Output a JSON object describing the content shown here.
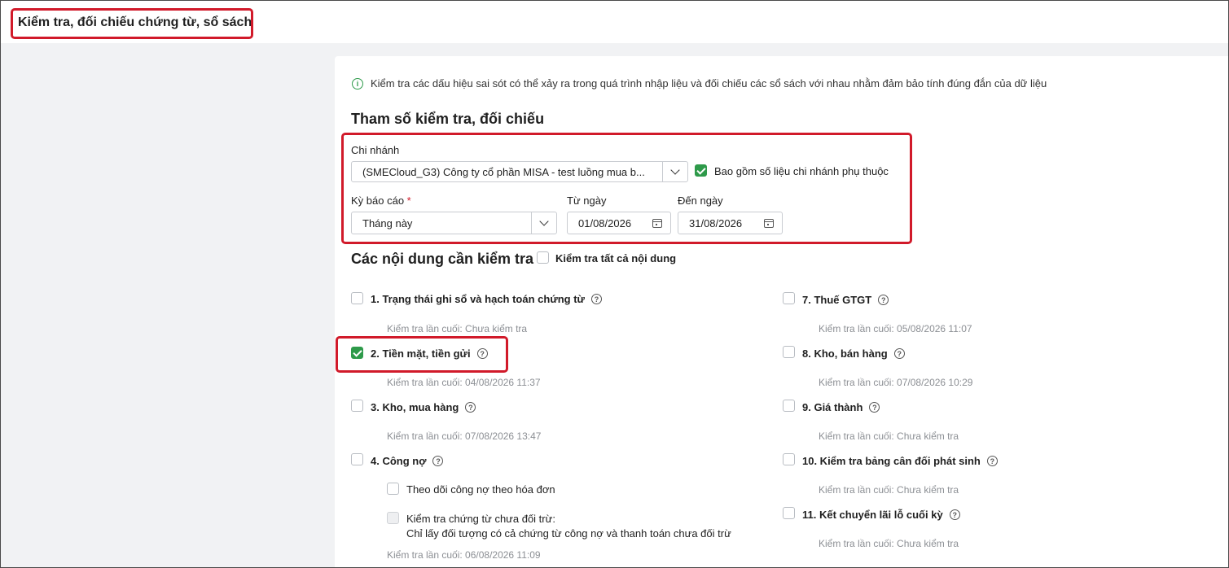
{
  "header": {
    "title": "Kiểm tra, đối chiếu chứng từ, sổ sách"
  },
  "info_text": "Kiểm tra các dấu hiệu sai sót có thể xảy ra trong quá trình nhập liệu và đối chiếu các sổ sách với nhau nhằm đảm bảo tính đúng đắn của dữ liệu",
  "params": {
    "heading": "Tham số kiểm tra, đối chiếu",
    "branch_label": "Chi nhánh",
    "branch_value": "(SMECloud_G3) Công ty cổ phần MISA - test luồng mua b...",
    "include_dependent_label": "Bao gồm số liệu chi nhánh phụ thuộc",
    "include_dependent_checked": true,
    "period_label": "Kỳ báo cáo",
    "period_required_mark": "*",
    "period_value": "Tháng này",
    "from_label": "Từ ngày",
    "from_value": "01/08/2026",
    "to_label": "Đến ngày",
    "to_value": "31/08/2026"
  },
  "contents": {
    "heading": "Các nội dung cần kiểm tra",
    "check_all_label": "Kiểm tra tất cả nội dung",
    "check_all_checked": false,
    "left": [
      {
        "label": "1. Trạng thái ghi sổ và hạch toán chứng từ",
        "last": "Kiểm tra lần cuối: Chưa kiểm tra",
        "checked": false
      },
      {
        "label": "2. Tiền mặt, tiền gửi",
        "last": "Kiểm tra lần cuối: 04/08/2026 11:37",
        "checked": true
      },
      {
        "label": "3. Kho, mua hàng",
        "last": "Kiểm tra lần cuối: 07/08/2026 13:47",
        "checked": false
      },
      {
        "label": "4. Công nợ",
        "last": "Kiểm tra lần cuối: 06/08/2026 11:09",
        "checked": false
      }
    ],
    "debt_sub": {
      "opt1": "Theo dõi công nợ theo hóa đơn",
      "opt2_line1": "Kiểm tra chứng từ chưa đối trừ:",
      "opt2_line2": "Chỉ lấy đối tượng có cả chứng từ công nợ và thanh toán chưa đối trừ"
    },
    "right": [
      {
        "label": "7. Thuế GTGT",
        "last": "Kiểm tra lần cuối: 05/08/2026 11:07",
        "checked": false
      },
      {
        "label": "8. Kho, bán hàng",
        "last": "Kiểm tra lần cuối: 07/08/2026 10:29",
        "checked": false
      },
      {
        "label": "9. Giá thành",
        "last": "Kiểm tra lần cuối: Chưa kiểm tra",
        "checked": false
      },
      {
        "label": "10. Kiểm tra bảng cân đối phát sinh",
        "last": "Kiểm tra lần cuối: Chưa kiểm tra",
        "checked": false
      },
      {
        "label": "11. Kết chuyển lãi lỗ cuối kỳ",
        "last": "Kiểm tra lần cuối: Chưa kiểm tra",
        "checked": false
      }
    ]
  },
  "colors": {
    "accent": "#2e9a4a",
    "highlight": "#d11a2a"
  }
}
